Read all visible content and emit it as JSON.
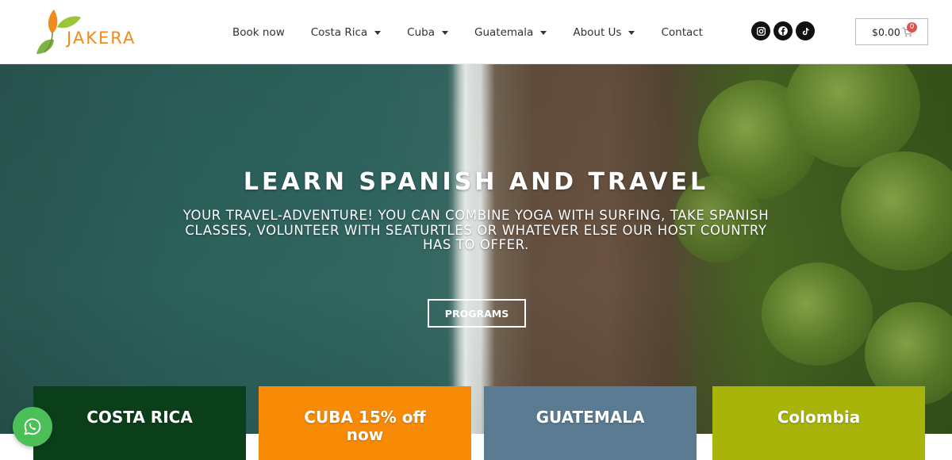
{
  "brand": {
    "name": "JAKERA",
    "colors": {
      "orange": "#f08a1c",
      "green": "#7cb342"
    }
  },
  "nav": {
    "items": [
      {
        "label": "Book now",
        "dropdown": false
      },
      {
        "label": "Costa Rica",
        "dropdown": true
      },
      {
        "label": "Cuba",
        "dropdown": true
      },
      {
        "label": "Guatemala",
        "dropdown": true
      },
      {
        "label": "About Us",
        "dropdown": true
      },
      {
        "label": "Contact",
        "dropdown": false
      }
    ]
  },
  "socials": [
    "instagram-icon",
    "facebook-icon",
    "tiktok-icon"
  ],
  "cart": {
    "amount": "$0.00",
    "count": "0"
  },
  "hero": {
    "title": "LEARN SPANISH AND TRAVEL",
    "subtitle_lines": [
      "YOUR TRAVEL-ADVENTURE! YOU CAN COMBINE YOGA WITH SURFING, TAKE SPANISH",
      "CLASSES, VOLUNTEER WITH SEATURTLES OR WHATEVER ELSE OUR HOST COUNTRY",
      "HAS TO OFFER."
    ],
    "button_label": "PROGRAMS"
  },
  "cards": [
    {
      "title_lines": [
        "COSTA RICA"
      ],
      "color": "#0b3f1a"
    },
    {
      "title_lines": [
        "CUBA 15% off",
        "now"
      ],
      "color": "#f78b05"
    },
    {
      "title_lines": [
        "GUATEMALA"
      ],
      "color": "#5b7b93"
    },
    {
      "title_lines": [
        "Colombia"
      ],
      "color": "#a9b40a"
    }
  ],
  "whatsapp": {
    "icon": "whatsapp-icon",
    "color": "#4dbf58"
  }
}
